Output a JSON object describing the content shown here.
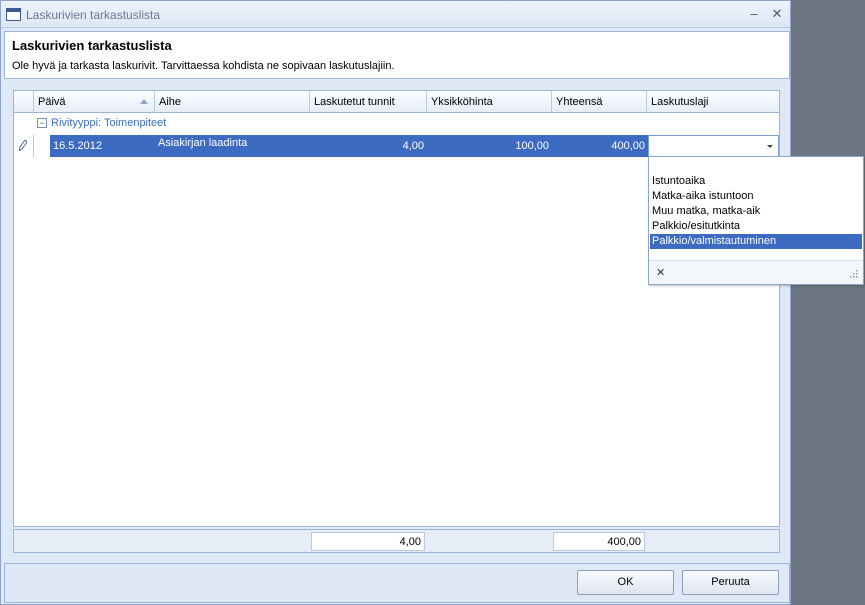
{
  "window": {
    "title": "Laskurivien tarkastuslista",
    "minimize_glyph": "–",
    "close_glyph": "✕"
  },
  "header": {
    "title": "Laskurivien tarkastuslista",
    "subtitle": "Ole hyvä ja tarkasta laskurivit. Tarvittaessa kohdista ne sopivaan laskutuslajiin."
  },
  "grid": {
    "columns": {
      "date": "Päivä",
      "subject": "Aihe",
      "hours": "Laskutetut tunnit",
      "unit_price": "Yksikköhinta",
      "total": "Yhteensä",
      "billing_type": "Laskutuslaji"
    },
    "group": {
      "toggle_glyph": "−",
      "label": "Rivityyppi: Toimenpiteet"
    },
    "row": {
      "date": "16.5.2012",
      "subject": "Asiakirjan laadinta",
      "hours": "4,00",
      "unit_price": "100,00",
      "total": "400,00",
      "billing_type": ""
    },
    "footer": {
      "hours_sum": "4,00",
      "total_sum": "400,00"
    }
  },
  "dropdown": {
    "options": [
      "Istuntoaika",
      "Matka-aika istuntoon",
      "Muu matka, matka-aik",
      "Palkkio/esitutkinta",
      "Palkkio/valmistautuminen"
    ],
    "selected": "Palkkio/valmistautuminen",
    "close_glyph": "✕"
  },
  "buttons": {
    "ok": "OK",
    "cancel": "Peruuta"
  },
  "colors": {
    "selection": "#3d6bc2",
    "group_text": "#3b6fb4"
  }
}
